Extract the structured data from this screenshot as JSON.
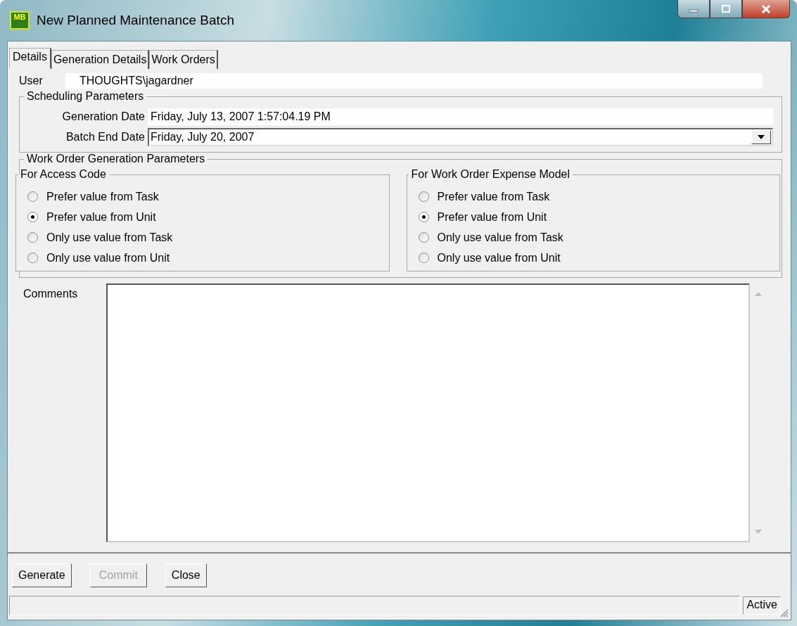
{
  "window": {
    "title": "New Planned Maintenance Batch",
    "icon_text": "MB"
  },
  "tabs": [
    {
      "label": "Details",
      "selected": true
    },
    {
      "label": "Generation Details",
      "selected": false
    },
    {
      "label": "Work Orders",
      "selected": false
    }
  ],
  "user": {
    "label": "User",
    "value": "THOUGHTS\\jagardner"
  },
  "scheduling": {
    "title": "Scheduling Parameters",
    "generation_date": {
      "label": "Generation Date",
      "value": "Friday, July 13, 2007 1:57:04.19 PM"
    },
    "batch_end_date": {
      "label": "Batch End Date",
      "value": "Friday, July 20, 2007"
    }
  },
  "generation": {
    "title": "Work Order Generation Parameters",
    "groups": [
      {
        "title": "For Access Code",
        "options": [
          {
            "label": "Prefer value from Task",
            "selected": false
          },
          {
            "label": "Prefer value from Unit",
            "selected": true
          },
          {
            "label": "Only use value from Task",
            "selected": false
          },
          {
            "label": "Only use value from Unit",
            "selected": false
          }
        ]
      },
      {
        "title": "For Work Order Expense Model",
        "options": [
          {
            "label": "Prefer value from Task",
            "selected": false
          },
          {
            "label": "Prefer value from Unit",
            "selected": true
          },
          {
            "label": "Only use value from Task",
            "selected": false
          },
          {
            "label": "Only use value from Unit",
            "selected": false
          }
        ]
      }
    ]
  },
  "comments": {
    "label": "Comments"
  },
  "buttons": [
    {
      "label": "Generate",
      "disabled": false
    },
    {
      "label": "Commit",
      "disabled": true
    },
    {
      "label": "Close",
      "disabled": false
    }
  ],
  "status_bar": {
    "status": "Active"
  }
}
